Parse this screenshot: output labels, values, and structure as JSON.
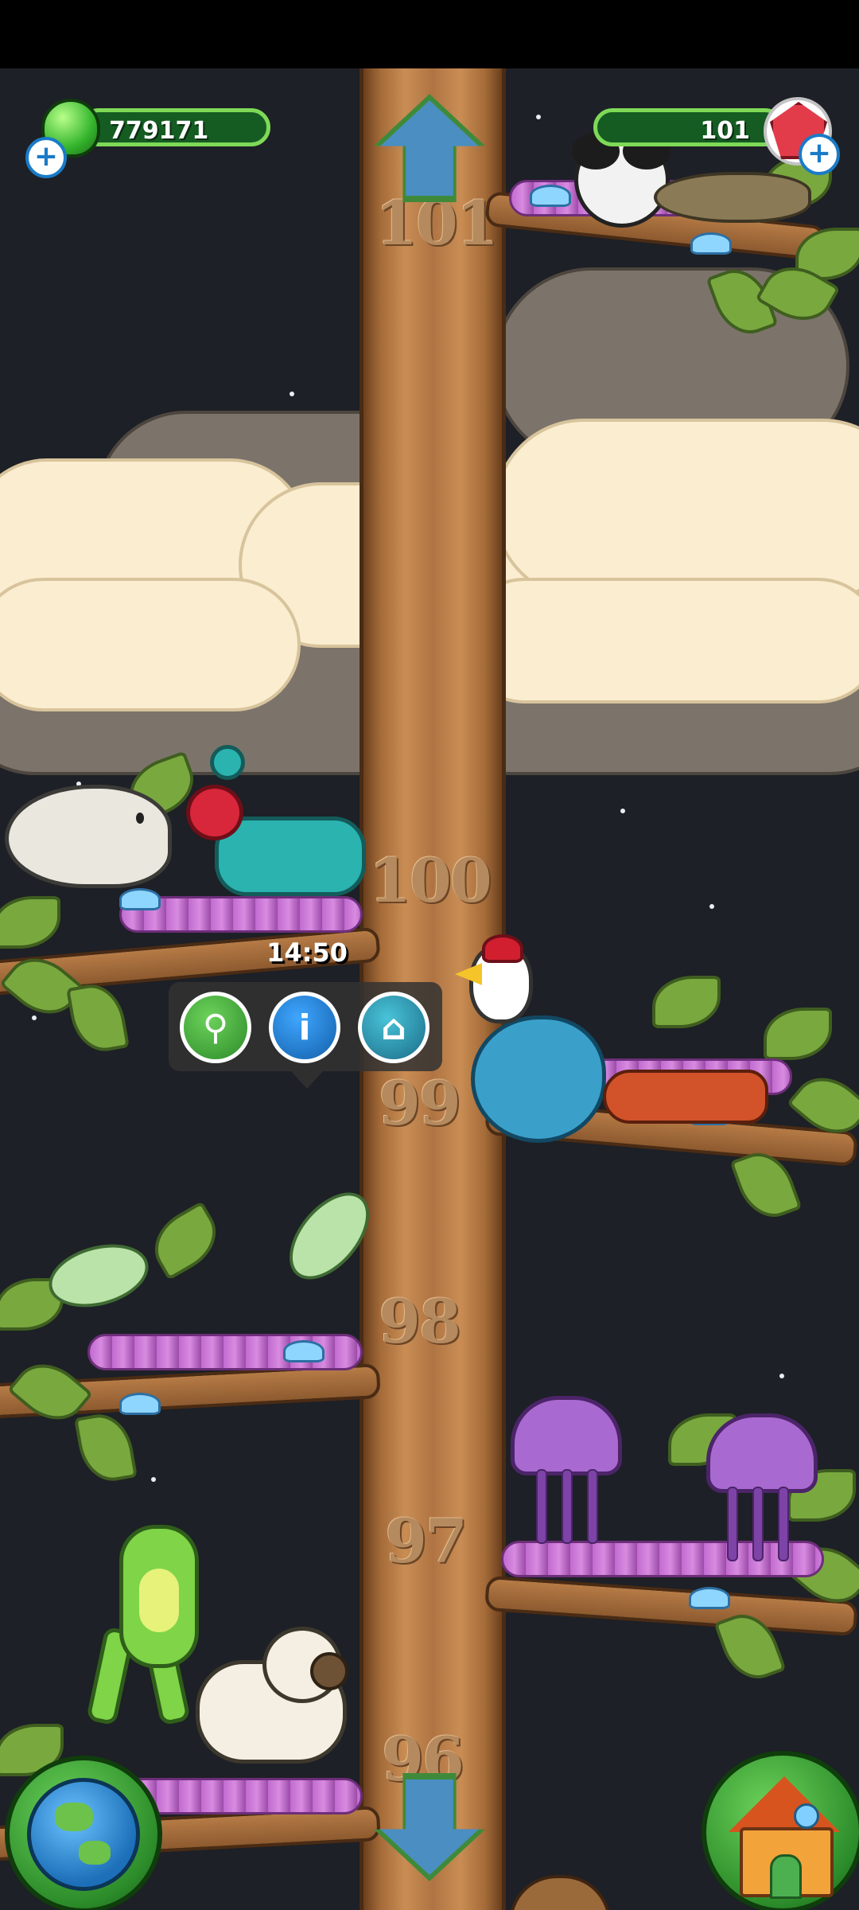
{
  "hud": {
    "coins_value": "779171",
    "gems_value": "101",
    "coin_plus_label": "+",
    "gem_plus_label": "+"
  },
  "floors": [
    "101",
    "100",
    "99",
    "98",
    "97",
    "96"
  ],
  "popup": {
    "timer": "14:50",
    "net_icon": "net-icon",
    "info_label": "i",
    "home_icon": "habitat-icon"
  },
  "nav": {
    "up_icon": "arrow-up-icon",
    "down_icon": "arrow-down-icon",
    "left_icon": "globe-icon",
    "right_icon": "house-icon"
  },
  "colors": {
    "trunk": "#c98d54",
    "sky": "#1d2026",
    "hud_green": "#7ed957",
    "nest_purple": "#c16bd0"
  }
}
